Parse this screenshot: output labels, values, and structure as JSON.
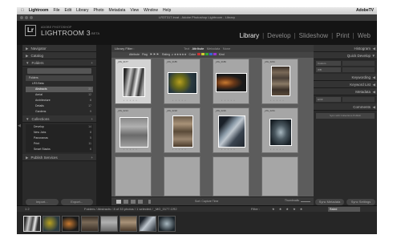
{
  "menubar": {
    "apple": "",
    "items": [
      "Lightroom",
      "File",
      "Edit",
      "Library",
      "Photo",
      "Metadata",
      "View",
      "Window",
      "Help"
    ],
    "right": "AdobeTV"
  },
  "window_title": "LR3T317.lrcat - Adobe Photoshop Lightroom - Library",
  "identity": {
    "badge": "Lr",
    "line1": "ADOBE PHOTOSHOP",
    "line2": "LIGHTROOM 3",
    "beta": "BETA",
    "modules": [
      "Library",
      "Develop",
      "Slideshow",
      "Print",
      "Web"
    ],
    "active_module": "Library"
  },
  "left_panel": {
    "navigator": "Navigator",
    "catalog": "Catalog",
    "folders": "Folders",
    "folder_search": "",
    "tree": [
      {
        "label": "Folders",
        "count": ""
      },
      {
        "label": "LR3 Beta",
        "count": ""
      },
      {
        "label": "Abstracts",
        "count": "33"
      },
      {
        "label": "Aerial",
        "count": "12"
      },
      {
        "label": "Architecture",
        "count": "8"
      },
      {
        "label": "Details",
        "count": "17"
      },
      {
        "label": "Gardens",
        "count": "9"
      }
    ],
    "collections": "Collections",
    "collection_items": [
      {
        "label": "Develop",
        "count": "14"
      },
      {
        "label": "New Jobs",
        "count": "8"
      },
      {
        "label": "Panoramas",
        "count": "5"
      },
      {
        "label": "Print",
        "count": "11"
      },
      {
        "label": "Smart Stacks",
        "count": "6"
      }
    ],
    "publish": "Publish Services",
    "import": "Import...",
    "export": "Export..."
  },
  "right_panel": {
    "histogram": "Histogram",
    "quick_develop": "Quick Develop",
    "qd_preset": "Custom",
    "qd_wb": "WB",
    "keywording": "Keywording",
    "keyword_list": "Keyword List",
    "metadata": "Metadata",
    "metadata_preset": "EXIF",
    "comments": "Comments",
    "sync_note": "Sync with Collections Publish",
    "sync_metadata": "Sync Metadata",
    "sync_settings": "Sync Settings"
  },
  "library_filter": {
    "title": "Library Filter :",
    "tabs": [
      "Text",
      "Attribute",
      "Metadata",
      "None"
    ],
    "active_tab": "Attribute",
    "attribute_label": "Attribute",
    "flag_label": "Flag",
    "rating_label": "Rating",
    "color_label": "Color",
    "kind_label": "Kind"
  },
  "grid": {
    "cells": [
      {
        "file": "_MG_0177"
      },
      {
        "file": "_MG_0185"
      },
      {
        "file": "_MG_0189"
      },
      {
        "file": "_MG_0201"
      },
      {
        "file": "_MG_0213"
      },
      {
        "file": "_MG_0218"
      },
      {
        "file": "_MG_0226"
      },
      {
        "file": "_MG_0231"
      }
    ]
  },
  "toolbar": {
    "sort_label": "Sort: Capture Time",
    "thumbnails": "Thumbnails"
  },
  "bottombar": {
    "nums": "1  2",
    "path": "Folders / Abstracts / 8 of 33 photos / 1 selected / _MG_0177.CR2",
    "filter": "Filter :",
    "stars": "★ ★ ★ ★ ★",
    "filter_preset": "Rated"
  },
  "filmstrip_count": 8
}
